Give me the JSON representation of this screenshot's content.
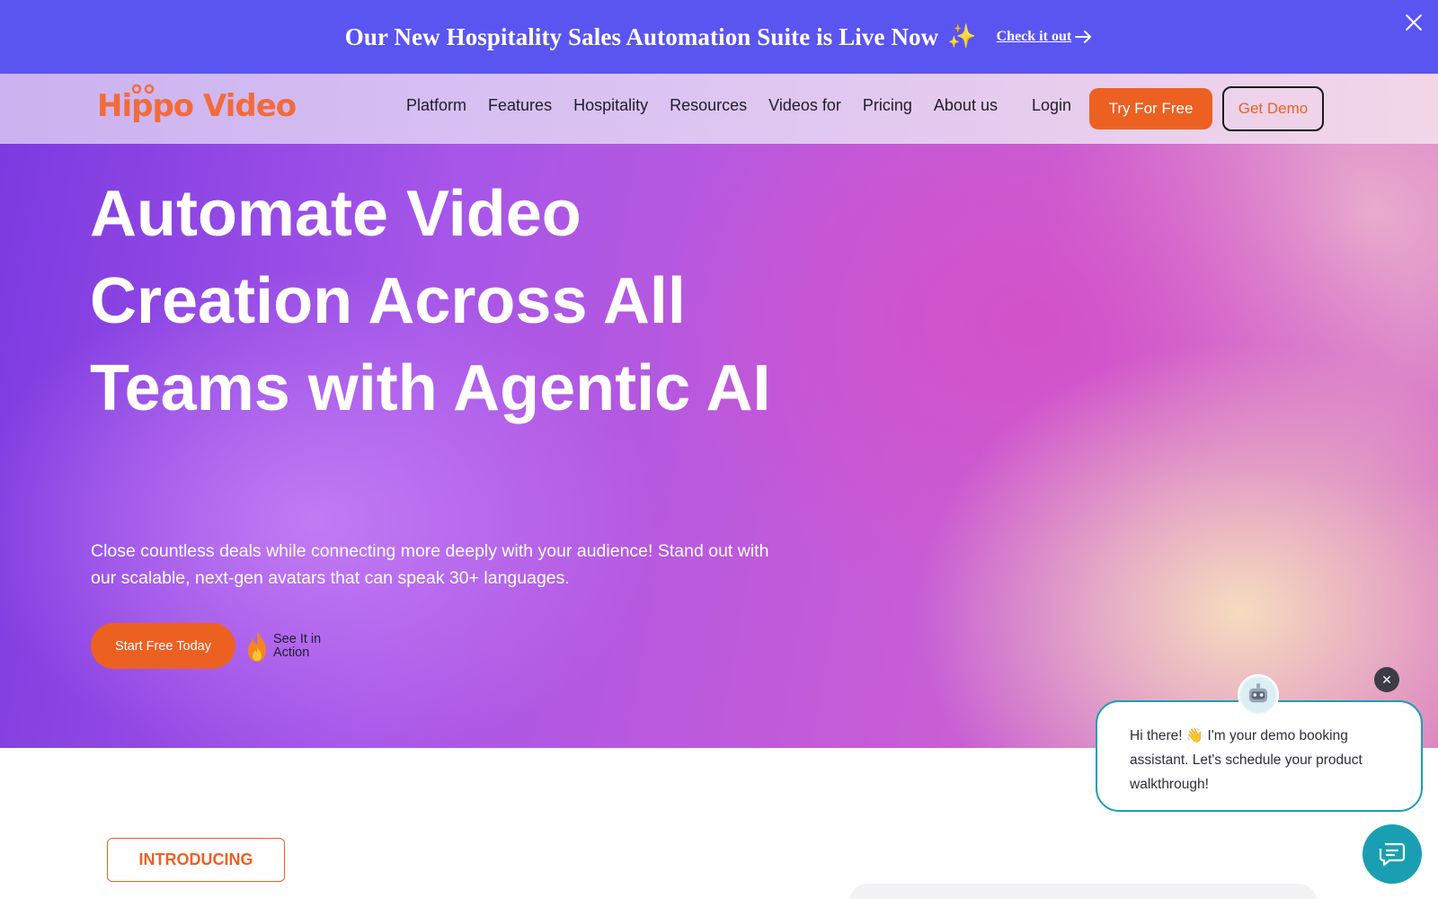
{
  "announcement": {
    "text": "Our New Hospitality Sales Automation Suite is Live Now",
    "emoji": "✨",
    "link_label": "Check it out"
  },
  "nav": {
    "logo_text": "Hippo Video",
    "items": [
      {
        "label": "Platform"
      },
      {
        "label": "Features"
      },
      {
        "label": "Hospitality"
      },
      {
        "label": "Resources"
      },
      {
        "label": "Videos for"
      },
      {
        "label": "Pricing"
      },
      {
        "label": "About us"
      }
    ],
    "login_label": "Login",
    "try_label": "Try For Free",
    "demo_label": "Get Demo"
  },
  "hero": {
    "title": "Automate Video Creation Across All Teams with Agentic AI",
    "subtitle": "Close countless deals while connecting more deeply with your audience! Stand out with our scalable, next-gen avatars that can speak 30+ languages.",
    "primary_cta": "Start Free Today",
    "secondary_cta": "See It in Action"
  },
  "section": {
    "badge": "INTRODUCING"
  },
  "chat": {
    "message": "Hi there! 👋 I'm your demo booking assistant. Let's schedule your product walkthrough!",
    "close_symbol": "✕"
  },
  "colors": {
    "banner": "#5a55f0",
    "accent_orange": "#ec6122",
    "chat_teal": "#1a9fb2"
  }
}
